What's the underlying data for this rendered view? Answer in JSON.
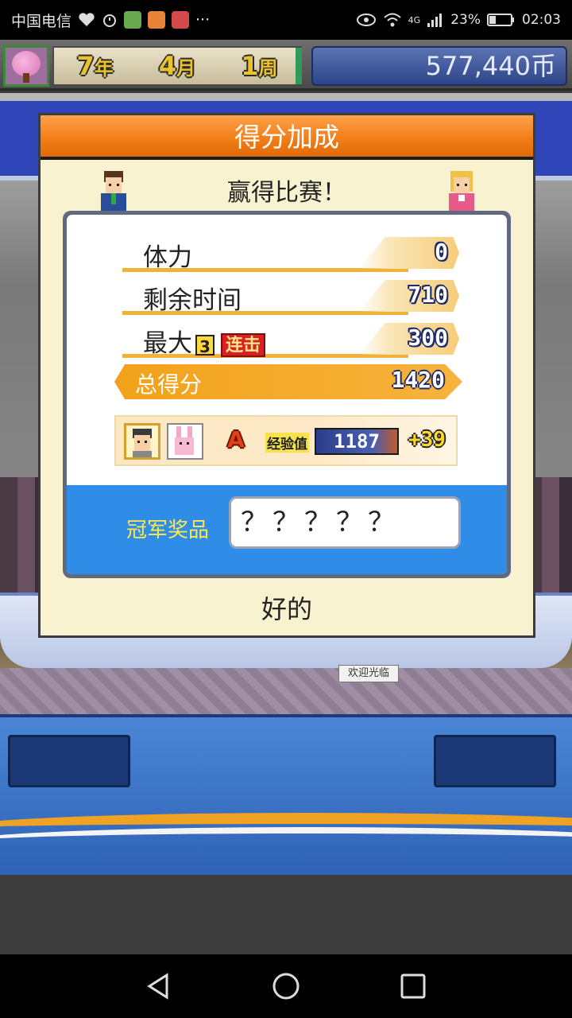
{
  "status_bar": {
    "carrier": "中国电信",
    "battery": "23%",
    "time": "02:03",
    "signal": "4G"
  },
  "hud": {
    "year_num": "7",
    "year_unit": "年",
    "month_num": "4",
    "month_unit": "月",
    "week_num": "1",
    "week_unit": "周",
    "money": "577,440币"
  },
  "background": {
    "welcome_sign": "欢迎光临"
  },
  "dialog": {
    "title": "得分加成",
    "subtitle": "赢得比赛！",
    "rows": [
      {
        "label": "体力",
        "value": "0"
      },
      {
        "label": "剩余时间",
        "value": "710"
      },
      {
        "label": "最大",
        "value": "300",
        "combo_count": "3",
        "combo_tag": "连击"
      }
    ],
    "total": {
      "label": "总得分",
      "value": "1420"
    },
    "exp": {
      "rank": "A",
      "label": "经验值",
      "value": "1187",
      "gain": "+39"
    },
    "prize": {
      "label": "冠军奖品",
      "value": "？？？？？"
    },
    "ok_label": "好的"
  },
  "colors": {
    "header_orange": "#f07c14",
    "dialog_bg": "#f8f2d0",
    "prize_blue": "#2f8de8",
    "prize_label": "#ffe94a"
  }
}
